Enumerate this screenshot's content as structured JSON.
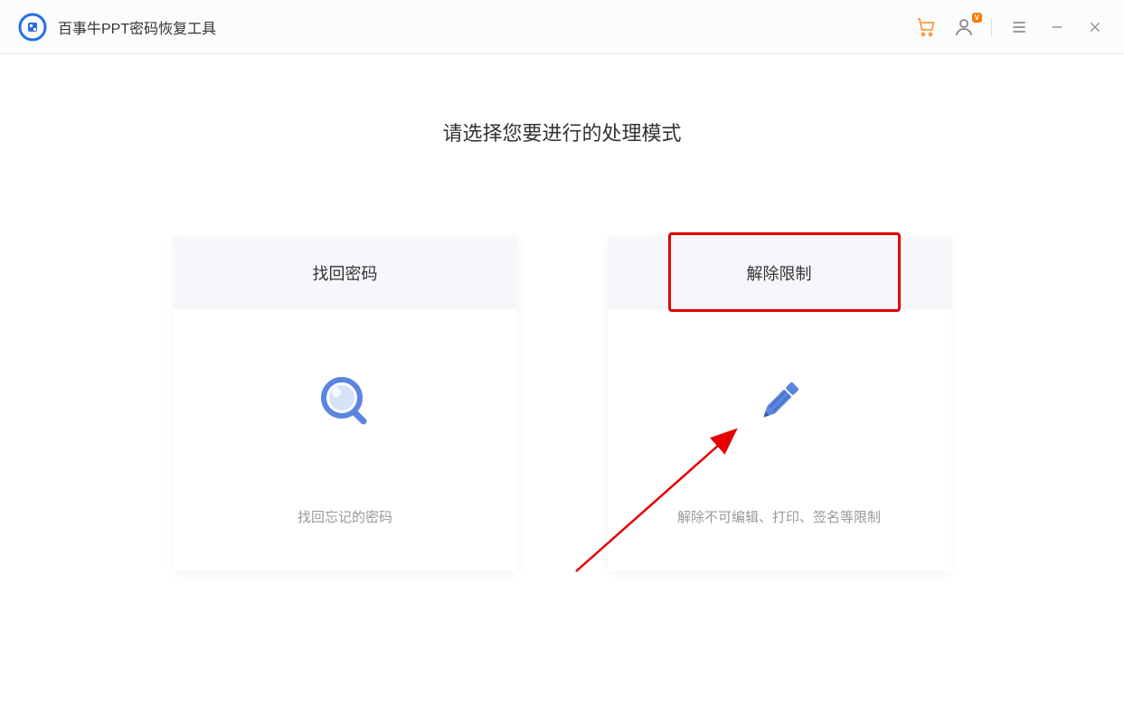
{
  "app": {
    "title": "百事牛PPT密码恢复工具"
  },
  "titlebar": {
    "vip_badge": "V"
  },
  "main": {
    "heading": "请选择您要进行的处理模式",
    "cards": [
      {
        "title": "找回密码",
        "description": "找回忘记的密码"
      },
      {
        "title": "解除限制",
        "description": "解除不可编辑、打印、签名等限制"
      }
    ]
  }
}
